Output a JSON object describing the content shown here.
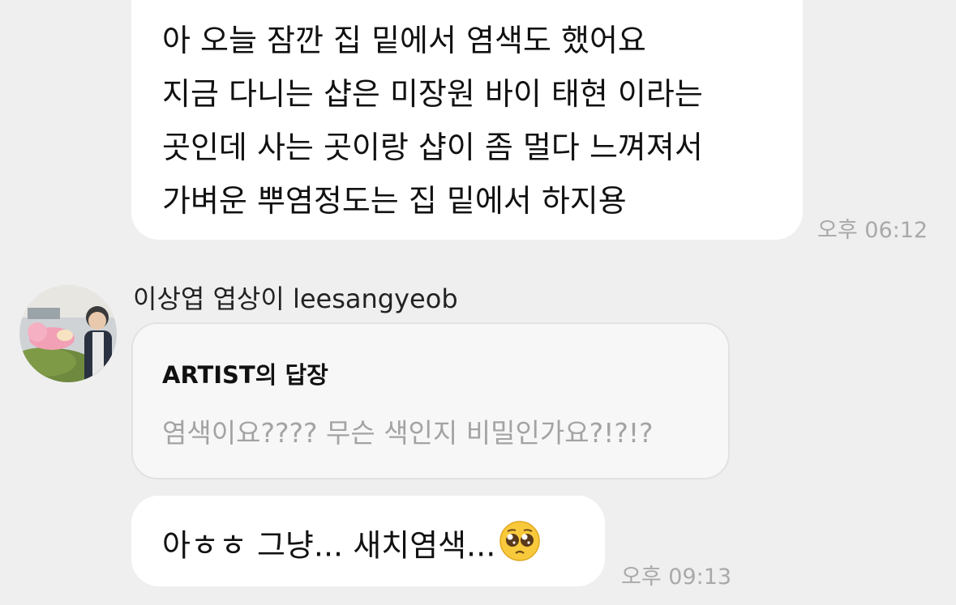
{
  "message1": {
    "lines": [
      "아 오늘 잠깐 집 밑에서 염색도 했어요",
      "지금 다니는 샵은 미장원 바이 태현 이라는",
      "곳인데 사는 곳이랑 샵이 좀 멀다 느껴져서",
      "가벼운 뿌염정도는 집 밑에서 하지용"
    ],
    "time": "오후 06:12"
  },
  "fan": {
    "sender_name": "이상엽 엽상이 leesangyeob",
    "reply_title": "ARTIST의 답장",
    "reply_text": "염색이요???? 무슨 색인지 비밀인가요?!?!?"
  },
  "message2": {
    "text": "아ㅎㅎ 그냥... 새치염색...",
    "emoji": "pleading-face",
    "time": "오후 09:13"
  },
  "colors": {
    "background": "#efefef",
    "bubble": "#ffffff",
    "reply_card": "#f7f7f7",
    "timestamp": "#a9a9a9"
  }
}
